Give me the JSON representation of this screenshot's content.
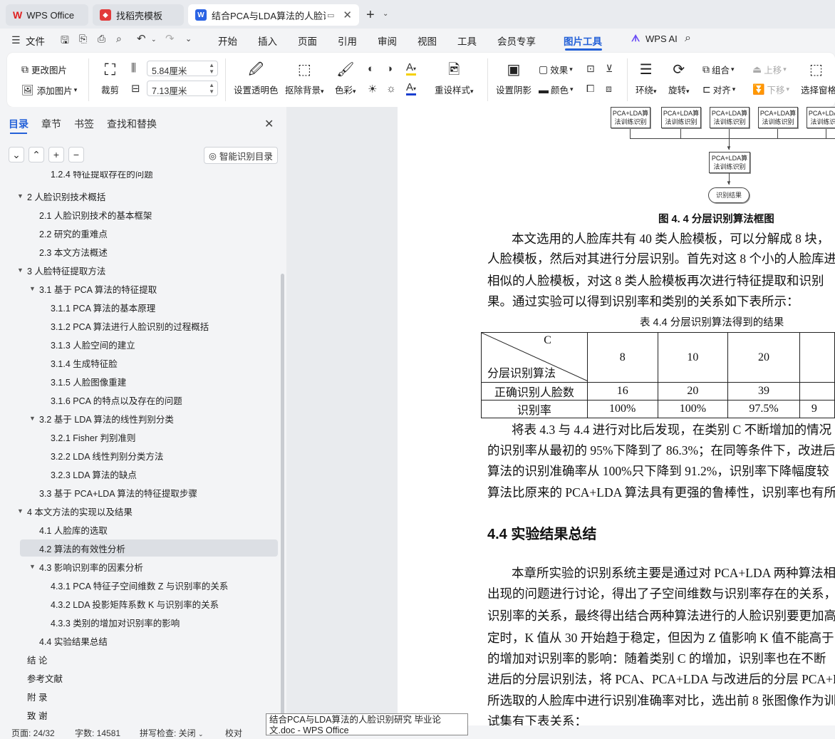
{
  "tabs": [
    {
      "label": "WPS Office"
    },
    {
      "label": "找稻壳模板"
    },
    {
      "label": "结合PCA与LDA算法的人脸识别"
    }
  ],
  "menu": [
    "文件",
    "开始",
    "插入",
    "页面",
    "引用",
    "审阅",
    "视图",
    "工具",
    "会员专享",
    "图片工具",
    "WPS AI"
  ],
  "ribbon": {
    "change_image": "更改图片",
    "add_image": "添加图片",
    "crop": "裁剪",
    "width": "5.84厘米",
    "height": "7.13厘米",
    "set_transparent": "设置透明色",
    "remove_bg": "抠除背景",
    "color_tone": "色彩",
    "reset_style": "重设样式",
    "set_shadow": "设置阴影",
    "effect": "效果",
    "fill_color": "颜色",
    "wrap": "环绕",
    "rotate": "旋转",
    "group": "组合",
    "align": "对齐",
    "move_up": "上移",
    "move_down": "下移",
    "select_pane": "选择窗格"
  },
  "panel": {
    "tabs": [
      "目录",
      "章节",
      "书签",
      "查找和替换"
    ],
    "smart_toc": "智能识别目录"
  },
  "toc": [
    {
      "text": "1.2.4 特征提取存在的问题",
      "lvl": 3
    },
    {
      "text": "2 人脸识别技术概括",
      "lvl": 1,
      "tw": "▼"
    },
    {
      "text": "2.1 人脸识别技术的基本框架",
      "lvl": 2
    },
    {
      "text": "2.2 研究的重难点",
      "lvl": 2
    },
    {
      "text": "2.3 本文方法概述",
      "lvl": 2
    },
    {
      "text": "3 人脸特征提取方法",
      "lvl": 1,
      "tw": "▼"
    },
    {
      "text": "3.1 基于 PCA 算法的特征提取",
      "lvl": 2,
      "tw": "▼"
    },
    {
      "text": "3.1.1 PCA 算法的基本原理",
      "lvl": 3
    },
    {
      "text": "3.1.2 PCA 算法进行人脸识别的过程概括",
      "lvl": 3
    },
    {
      "text": "3.1.3 人脸空间的建立",
      "lvl": 3
    },
    {
      "text": "3.1.4 生成特征脸",
      "lvl": 3
    },
    {
      "text": "3.1.5 人脸图像重建",
      "lvl": 3
    },
    {
      "text": "3.1.6 PCA 的特点以及存在的问题",
      "lvl": 3
    },
    {
      "text": "3.2 基于 LDA 算法的线性判别分类",
      "lvl": 2,
      "tw": "▼"
    },
    {
      "text": "3.2.1 Fisher 判别准则",
      "lvl": 3
    },
    {
      "text": "3.2.2 LDA 线性判别分类方法",
      "lvl": 3
    },
    {
      "text": "3.2.3 LDA 算法的缺点",
      "lvl": 3
    },
    {
      "text": "3.3 基于 PCA+LDA 算法的特征提取步骤",
      "lvl": 2
    },
    {
      "text": "4 本文方法的实现以及结果",
      "lvl": 1,
      "tw": "▼"
    },
    {
      "text": "4.1 人脸库的选取",
      "lvl": 2
    },
    {
      "text": "4.2 算法的有效性分析",
      "lvl": 2,
      "sel": true
    },
    {
      "text": "4.3 影响识别率的因素分析",
      "lvl": 2,
      "tw": "▼"
    },
    {
      "text": "4.3.1 PCA 特征子空间维数 Z 与识别率的关系",
      "lvl": 3
    },
    {
      "text": "4.3.2 LDA 投影矩阵系数 K 与识别率的关系",
      "lvl": 3
    },
    {
      "text": "4.3.3 类别的增加对识别率的影响",
      "lvl": 3
    },
    {
      "text": "4.4 实验结果总结",
      "lvl": 2
    },
    {
      "text": "结 论",
      "lvl": 1
    },
    {
      "text": "参考文献",
      "lvl": 1
    },
    {
      "text": "附 录",
      "lvl": 1
    },
    {
      "text": "致 谢",
      "lvl": 1
    }
  ],
  "doc": {
    "flow_box": "PCA+LDA算法训练识别",
    "flow_end": "识别结果",
    "fig_caption": "图 4. 4 分层识别算法框图",
    "para1": [
      "本文选用的人脸库共有 40 类人脸模板，可以分解成 8 块，",
      "人脸模板，然后对其进行分层识别。首先对这 8 个小的人脸库进",
      "相似的人脸模板，对这 8 类人脸模板再次进行特征提取和识别",
      "果。通过实验可以得到识别率和类别的关系如下表所示："
    ],
    "table_caption": "表 4.4 分层识别算法得到的结果",
    "table": {
      "corner_top": "C",
      "corner_bottom": "分层识别算法",
      "cols": [
        "8",
        "10",
        "20",
        ""
      ],
      "rows": [
        {
          "label": "正确识别人脸数",
          "vals": [
            "16",
            "20",
            "39",
            ""
          ]
        },
        {
          "label": "识别率",
          "vals": [
            "100%",
            "100%",
            "97.5%",
            "9"
          ]
        }
      ]
    },
    "para2": [
      "将表 4.3 与 4.4 进行对比后发现，在类别 C 不断增加的情况",
      "的识别率从最初的 95%下降到了 86.3%；在同等条件下，改进后",
      "算法的识别准确率从 100%只下降到 91.2%，识别率下降幅度较",
      "算法比原来的 PCA+LDA 算法具有更强的鲁棒性，识别率也有所"
    ],
    "heading": "4.4 实验结果总结",
    "para3": [
      "本章所实验的识别系统主要是通过对 PCA+LDA 两种算法相",
      "出现的问题进行讨论，得出了子空间维数与识别率存在的关系，",
      "识别率的关系，最终得出结合两种算法进行的人脸识别要更加高",
      "定时，K 值从 30 开始趋于稳定，但因为 Z 值影响 K 值不能高于",
      "的增加对识别率的影响：随着类别 C 的增加，识别率也在不断",
      "进后的分层识别法，将 PCA、PCA+LDA 与改进后的分层 PCA+L",
      "所选取的人脸库中进行识别准确率对比，选出前 8 张图像作为训",
      "试集有下表关系："
    ]
  },
  "status": {
    "page": "页面: 24/32",
    "words": "字数: 14581",
    "spell": "拼写检查: 关闭",
    "proof": "校对"
  },
  "tooltip": "结合PCA与LDA算法的人脸识别研究 毕业论文.doc - WPS Office"
}
